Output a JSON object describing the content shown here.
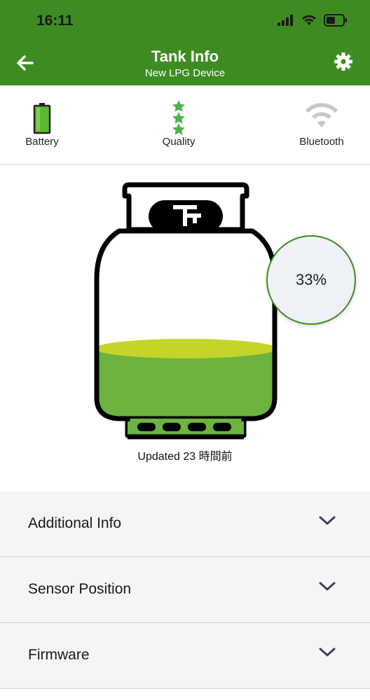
{
  "status_bar": {
    "time": "16:11",
    "signal_icon": "cellular-signal-icon",
    "wifi_icon": "wifi-icon",
    "battery_icon": "phone-battery-icon"
  },
  "header": {
    "title": "Tank Info",
    "subtitle": "New LPG Device",
    "back_icon": "back-arrow-icon",
    "settings_icon": "gear-icon",
    "background_color": "#3e8c21"
  },
  "status_row": {
    "battery": {
      "label": "Battery",
      "icon": "battery-icon"
    },
    "quality": {
      "label": "Quality",
      "icon": "star-icon",
      "stars": 3
    },
    "bluetooth": {
      "label": "Bluetooth",
      "icon": "bluetooth-signal-icon"
    }
  },
  "tank": {
    "level_percent": "33%",
    "fill_fraction": 0.33,
    "fill_color": "#6cb33f",
    "surface_color": "#c4d42a",
    "updated_text": "Updated 23 時間前"
  },
  "accordion": {
    "items": [
      {
        "label": "Additional Info",
        "icon": "chevron-down-icon"
      },
      {
        "label": "Sensor Position",
        "icon": "chevron-down-icon"
      },
      {
        "label": "Firmware",
        "icon": "chevron-down-icon"
      }
    ]
  }
}
